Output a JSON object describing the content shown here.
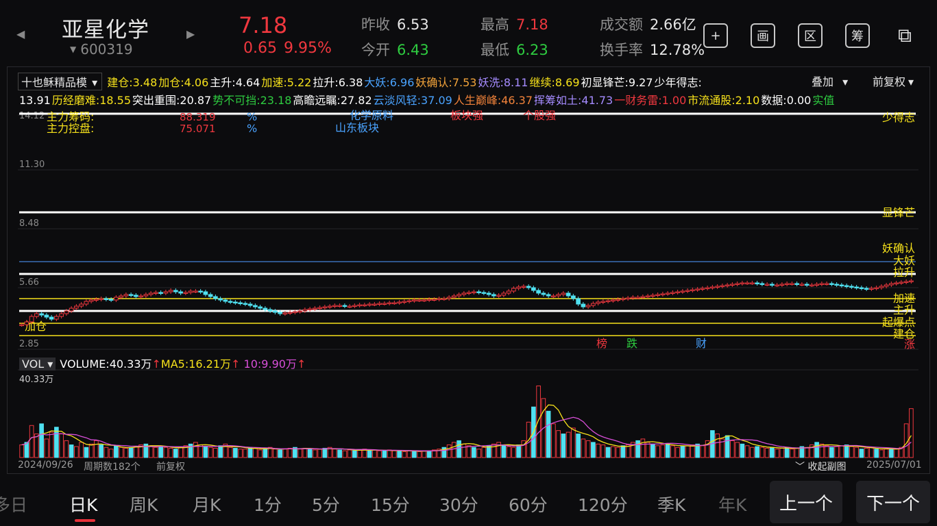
{
  "header": {
    "name": "亚星化学",
    "code": "600319",
    "price": "7.18",
    "change": "0.65",
    "change_pct": "9.95%",
    "stats": [
      {
        "key": "昨收",
        "val": "6.53",
        "color": "white"
      },
      {
        "key": "最高",
        "val": "7.18",
        "color": "red"
      },
      {
        "key": "成交额",
        "val": "2.66亿",
        "color": "white"
      },
      {
        "key": "今开",
        "val": "6.43",
        "color": "green"
      },
      {
        "key": "最低",
        "val": "6.23",
        "color": "green"
      },
      {
        "key": "换手率",
        "val": "12.78%",
        "color": "white"
      }
    ],
    "buttons": [
      {
        "name": "add-icon",
        "glyph": "+"
      },
      {
        "name": "draw-icon",
        "glyph": "画"
      },
      {
        "name": "zone-icon",
        "glyph": "区"
      },
      {
        "name": "chips-icon",
        "glyph": "筹"
      },
      {
        "name": "devices-icon",
        "glyph": "⧉"
      }
    ]
  },
  "indicator": {
    "template": "十也稣精品模",
    "overlay": "叠加",
    "adjust": "前复权",
    "row1": [
      {
        "t": "建仓:3.48",
        "c": "#f7e21b"
      },
      {
        "t": "加仓:4.06",
        "c": "#f7e21b"
      },
      {
        "t": "主升:4.64",
        "c": "#ffffff"
      },
      {
        "t": "加速:5.22",
        "c": "#f7e21b"
      },
      {
        "t": "拉升:6.38",
        "c": "#ffffff"
      },
      {
        "t": "大妖:6.96",
        "c": "#4aa3ff"
      },
      {
        "t": "妖确认:7.53",
        "c": "#f2a33a"
      },
      {
        "t": "妖洗:8.11",
        "c": "#a58bff"
      },
      {
        "t": "继续:8.69",
        "c": "#f7e21b"
      },
      {
        "t": "初显锋芒:9.27",
        "c": "#ffffff"
      },
      {
        "t": "少年得志:",
        "c": "#ffffff"
      }
    ],
    "row2": [
      {
        "t": "13.91",
        "c": "#ffffff"
      },
      {
        "t": "历经磨难:18.55",
        "c": "#f7e21b"
      },
      {
        "t": "突出重围:20.87",
        "c": "#ffffff"
      },
      {
        "t": "势不可挡:23.18",
        "c": "#2ecc40"
      },
      {
        "t": "高瞻远瞩:27.82",
        "c": "#ffffff"
      },
      {
        "t": "云淡风轻:37.09",
        "c": "#4aa3ff"
      },
      {
        "t": "人生巅峰:46.37",
        "c": "#f2833a"
      },
      {
        "t": "挥筹如土:41.73",
        "c": "#a58bff"
      },
      {
        "t": "一财务雷:1.00",
        "c": "#f0383f"
      },
      {
        "t": "市流通股:2.10",
        "c": "#f7e21b"
      },
      {
        "t": "数据:0.00",
        "c": "#ffffff"
      },
      {
        "t": "实值",
        "c": "#2ecc40"
      }
    ]
  },
  "overlay_text": {
    "main_chip": "主力筹码:",
    "main_chip_val": "88.319",
    "main_ctrl": "主力控盘:",
    "main_ctrl_val": "75.071",
    "pct": "%",
    "sector1": "化学原料",
    "sector2": "山东板块",
    "board_strong": "板块强",
    "stock_strong": "个股强",
    "top_right": "少得志"
  },
  "price_axis": [
    "14.12",
    "11.30",
    "8.48",
    "5.66",
    "2.85"
  ],
  "level_labels": [
    {
      "t": "显锋芒",
      "c": "#f7e21b"
    },
    {
      "t": "妖确认",
      "c": "#f7e21b"
    },
    {
      "t": "大妖",
      "c": "#f7e21b"
    },
    {
      "t": "拉升",
      "c": "#f7e21b"
    },
    {
      "t": "加速",
      "c": "#f7e21b"
    },
    {
      "t": "主升",
      "c": "#f7e21b"
    },
    {
      "t": "起爆点",
      "c": "#f7e21b"
    },
    {
      "t": "建仓",
      "c": "#f7e21b"
    },
    {
      "t": "涨",
      "c": "#f0383f"
    }
  ],
  "left_label": "加仓",
  "markers": [
    {
      "t": "榜",
      "c": "#f0383f"
    },
    {
      "t": "跌",
      "c": "#2ecc40"
    },
    {
      "t": "财",
      "c": "#4aa3ff"
    }
  ],
  "volume": {
    "selector": "VOL",
    "volume": "VOLUME:40.33万",
    "ma5": "MA5:16.21万",
    "ma10": "10:9.90万",
    "arrow": "↑",
    "axis_max": "40.33万"
  },
  "footer": {
    "start_date": "2024/09/26",
    "period_count": "周期数182个",
    "adjust": "前复权",
    "collapse": "收起副图",
    "end_date": "2025/07/01"
  },
  "tabs": [
    "多日",
    "日K",
    "周K",
    "月K",
    "1分",
    "5分",
    "15分",
    "30分",
    "60分",
    "120分",
    "季K",
    "年K"
  ],
  "prev_btn": "上一个",
  "next_btn": "下一个",
  "chart_data": {
    "type": "candlestick",
    "ylim": [
      2.85,
      14.12
    ],
    "volume_max": 40.33
  }
}
